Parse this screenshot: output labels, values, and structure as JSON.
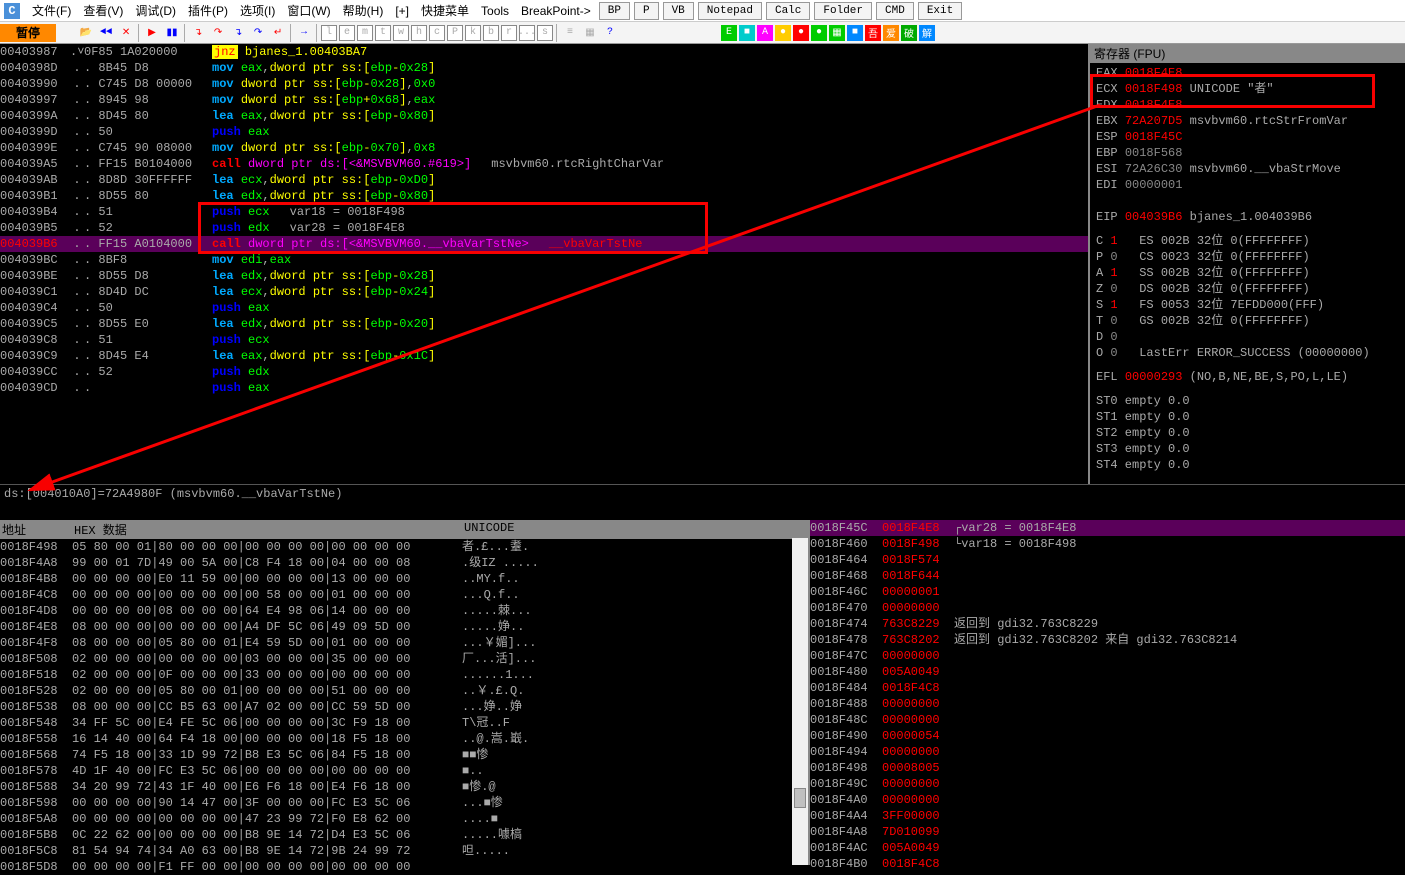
{
  "menu": {
    "items": [
      "文件(F)",
      "查看(V)",
      "调试(D)",
      "插件(P)",
      "选项(I)",
      "窗口(W)",
      "帮助(H)",
      "[+]",
      "快捷菜单",
      "Tools",
      "BreakPoint->"
    ],
    "bp_buttons": [
      "BP",
      "P",
      "VB",
      "Notepad",
      "Calc",
      "Folder",
      "CMD",
      "Exit"
    ]
  },
  "toolbar": {
    "pause_label": "暂停",
    "letters": [
      "l",
      "e",
      "m",
      "t",
      "w",
      "h",
      "c",
      "P",
      "k",
      "b",
      "r",
      "...",
      "s"
    ],
    "cjk_boxes": [
      "吾",
      "爱",
      "破",
      "解"
    ]
  },
  "disasm_title_row": {
    "addr": "00403987",
    "bytes": "0F85 1A020000",
    "label": "bjanes_1.00403BA7"
  },
  "disasm": [
    {
      "addr": "0040398D",
      "bytes": ". 8B45 D8",
      "mn": "mov",
      "ops": "eax,dword ptr ss:[ebp-0x28]"
    },
    {
      "addr": "00403990",
      "bytes": ". C745 D8 00000",
      "mn": "mov",
      "ops": "dword ptr ss:[ebp-0x28],0x0"
    },
    {
      "addr": "00403997",
      "bytes": ". 8945 98",
      "mn": "mov",
      "ops": "dword ptr ss:[ebp+0x68],eax"
    },
    {
      "addr": "0040399A",
      "bytes": ". 8D45 80",
      "mn": "lea",
      "ops": "eax,dword ptr ss:[ebp-0x80]"
    },
    {
      "addr": "0040399D",
      "bytes": ". 50",
      "mn": "push",
      "ops": "eax"
    },
    {
      "addr": "0040399E",
      "bytes": ". C745 90 08000",
      "mn": "mov",
      "ops": "dword ptr ss:[ebp-0x70],0x8"
    },
    {
      "addr": "004039A5",
      "bytes": ". FF15 B0104000",
      "mn": "call",
      "ops": "dword ptr ds:[<&MSVBVM60.#619>]",
      "cm": "msvbvm60.rtcRightCharVar"
    },
    {
      "addr": "004039AB",
      "bytes": ". 8D8D 30FFFFFF",
      "mn": "lea",
      "ops": "ecx,dword ptr ss:[ebp-0xD0]"
    },
    {
      "addr": "004039B1",
      "bytes": ". 8D55 80",
      "mn": "lea",
      "ops": "edx,dword ptr ss:[ebp-0x80]"
    },
    {
      "addr": "004039B4",
      "bytes": ". 51",
      "mn": "push",
      "ops": "ecx",
      "box": true,
      "cm": "var18 = 0018F498"
    },
    {
      "addr": "004039B5",
      "bytes": ". 52",
      "mn": "push",
      "ops": "edx",
      "box": true,
      "cm": "var28 = 0018F4E8"
    },
    {
      "addr": "004039B6",
      "bytes": ". FF15 A0104000",
      "mn": "call",
      "ops": "dword ptr ds:[<&MSVBVM60.__vbaVarTstNe>",
      "hl": true,
      "box": true,
      "red": true,
      "cm2": "__vbaVarTstNe"
    },
    {
      "addr": "004039BC",
      "bytes": ". 8BF8",
      "mn": "mov",
      "ops": "edi,eax"
    },
    {
      "addr": "004039BE",
      "bytes": ". 8D55 D8",
      "mn": "lea",
      "ops": "edx,dword ptr ss:[ebp-0x28]"
    },
    {
      "addr": "004039C1",
      "bytes": ". 8D4D DC",
      "mn": "lea",
      "ops": "ecx,dword ptr ss:[ebp-0x24]"
    },
    {
      "addr": "004039C4",
      "bytes": ". 50",
      "mn": "push",
      "ops": "eax"
    },
    {
      "addr": "004039C5",
      "bytes": ". 8D55 E0",
      "mn": "lea",
      "ops": "edx,dword ptr ss:[ebp-0x20]"
    },
    {
      "addr": "004039C8",
      "bytes": ". 51",
      "mn": "push",
      "ops": "ecx"
    },
    {
      "addr": "004039C9",
      "bytes": ". 8D45 E4",
      "mn": "lea",
      "ops": "eax,dword ptr ss:[ebp-0x1C]"
    },
    {
      "addr": "004039CC",
      "bytes": ". 52",
      "mn": "push",
      "ops": "edx"
    },
    {
      "addr": "004039CD",
      "bytes": ". ",
      "mn": "push",
      "ops": "eax"
    }
  ],
  "dsline": "ds:[004010A0]=72A4980F (msvbvm60.__vbaVarTstNe)",
  "registers_title": "寄存器 (FPU)",
  "registers": [
    {
      "n": "EAX",
      "v": "0018F4E8",
      "red": true
    },
    {
      "n": "ECX",
      "v": "0018F498",
      "red": true,
      "cm": "UNICODE \"者\"",
      "box": true
    },
    {
      "n": "EDX",
      "v": "0018F4E8",
      "red": true,
      "box": true
    },
    {
      "n": "EBX",
      "v": "72A207D5",
      "red": true,
      "cm": "msvbvm60.rtcStrFromVar"
    },
    {
      "n": "ESP",
      "v": "0018F45C",
      "red": true
    },
    {
      "n": "EBP",
      "v": "0018F568"
    },
    {
      "n": "ESI",
      "v": "72A26C30",
      "cm": "msvbvm60.__vbaStrMove"
    },
    {
      "n": "EDI",
      "v": "00000001"
    },
    {
      "n": "",
      "v": ""
    },
    {
      "n": "EIP",
      "v": "004039B6",
      "red": true,
      "cm": "bjanes_1.004039B6"
    }
  ],
  "flags": [
    {
      "n": "C",
      "v": "1",
      "r": "ES 002B 32位 0(FFFFFFFF)"
    },
    {
      "n": "P",
      "v": "0",
      "r": "CS 0023 32位 0(FFFFFFFF)"
    },
    {
      "n": "A",
      "v": "1",
      "r": "SS 002B 32位 0(FFFFFFFF)"
    },
    {
      "n": "Z",
      "v": "0",
      "r": "DS 002B 32位 0(FFFFFFFF)"
    },
    {
      "n": "S",
      "v": "1",
      "r": "FS 0053 32位 7EFDD000(FFF)"
    },
    {
      "n": "T",
      "v": "0",
      "r": "GS 002B 32位 0(FFFFFFFF)"
    },
    {
      "n": "D",
      "v": "0",
      "r": ""
    },
    {
      "n": "O",
      "v": "0",
      "r": "LastErr ERROR_SUCCESS (00000000)"
    }
  ],
  "efl": {
    "n": "EFL",
    "v": "00000293",
    "cm": "(NO,B,NE,BE,S,PO,L,LE)"
  },
  "fpu": [
    "ST0 empty 0.0",
    "ST1 empty 0.0",
    "ST2 empty 0.0",
    "ST3 empty 0.0",
    "ST4 empty 0.0"
  ],
  "hex_headers": {
    "addr": "地址",
    "data": "HEX 数据",
    "uni": "UNICODE"
  },
  "hex": [
    {
      "a": "0018F498",
      "b": "05 80 00 01 80 00 00 00 00 00 00 00 00 00 00 00",
      "u": "者.£...耋."
    },
    {
      "a": "0018F4A8",
      "b": "99 00 01 7D 49 00 5A 00 C8 F4 18 00 04 00 00 08",
      "u": ".级IZ ....."
    },
    {
      "a": "0018F4B8",
      "b": "00 00 00 00 E0 11 59 00 00 00 00 00 13 00 00 00",
      "u": "..MY.f.."
    },
    {
      "a": "0018F4C8",
      "b": "00 00 00 00 00 00 00 00 00 58 00 00 01 00 00 00",
      "u": "...Q.f.."
    },
    {
      "a": "0018F4D8",
      "b": "00 00 00 00 08 00 00 00 64 E4 98 06 14 00 00 00",
      "u": ".....棘..."
    },
    {
      "a": "0018F4E8",
      "b": "08 00 00 00 00 00 00 00 A4 DF 5C 06 49 09 5D 00",
      "u": ".....婙.."
    },
    {
      "a": "0018F4F8",
      "b": "08 00 00 00 05 80 00 01 E4 59 5D 00 01 00 00 00",
      "u": "...￥媚]..."
    },
    {
      "a": "0018F508",
      "b": "02 00 00 00 00 00 00 00 03 00 00 00 35 00 00 00",
      "u": "厂...活]..."
    },
    {
      "a": "0018F518",
      "b": "02 00 00 00 0F 00 00 00 33 00 00 00 00 00 00 00",
      "u": "......1..."
    },
    {
      "a": "0018F528",
      "b": "02 00 00 00 05 80 00 01 00 00 00 00 51 00 00 00",
      "u": "..￥.£.Q."
    },
    {
      "a": "0018F538",
      "b": "08 00 00 00 CC B5 63 00 A7 02 00 00 CC 59 5D 00",
      "u": "...婙..婙"
    },
    {
      "a": "0018F548",
      "b": "34 FF 5C 00 E4 FE 5C 06 00 00 00 00 3C F9 18 00",
      "u": "T\\冠..F"
    },
    {
      "a": "0018F558",
      "b": "16 14 40 00 64 F4 18 00 00 00 00 00 18 F5 18 00",
      "u": "..@.嵩.嶯."
    },
    {
      "a": "0018F568",
      "b": "74 F5 18 00 33 1D 99 72 B8 E3 5C 06 84 F5 18 00",
      "u": "■■惨"
    },
    {
      "a": "0018F578",
      "b": "4D 1F 40 00 FC E3 5C 06 00 00 00 00 00 00 00 00",
      "u": "■.."
    },
    {
      "a": "0018F588",
      "b": "34 20 99 72 43 1F 40 00 E6 F6 18 00 E4 F6 18 00",
      "u": "■惨.@"
    },
    {
      "a": "0018F598",
      "b": "00 00 00 00 90 14 47 00 3F 00 00 00 FC E3 5C 06",
      "u": "...■惨"
    },
    {
      "a": "0018F5A8",
      "b": "00 00 00 00 00 00 00 00 47 23 99 72 F0 E8 62 00",
      "u": "....■"
    },
    {
      "a": "0018F5B8",
      "b": "0C 22 62 00 00 00 00 00 B8 9E 14 72 D4 E3 5C 06",
      "u": ".....噱槁"
    },
    {
      "a": "0018F5C8",
      "b": "81 54 94 74 34 A0 63 00 B8 9E 14 72 9B 24 99 72",
      "u": "呾....."
    },
    {
      "a": "0018F5D8",
      "b": "00 00 00 00 F1 FF 00 00 00 00 00 00 00 00 00 00",
      "u": ""
    }
  ],
  "stack": [
    {
      "a": "0018F45C",
      "v": "0018F4E8",
      "hl": true,
      "c": "┌var28 = 0018F4E8"
    },
    {
      "a": "0018F460",
      "v": "0018F498",
      "c": "└var18 = 0018F498"
    },
    {
      "a": "0018F464",
      "v": "0018F574"
    },
    {
      "a": "0018F468",
      "v": "0018F644"
    },
    {
      "a": "0018F46C",
      "v": "00000001"
    },
    {
      "a": "0018F470",
      "v": "00000000"
    },
    {
      "a": "0018F474",
      "v": "763C8229",
      "c": "返回到 gdi32.763C8229"
    },
    {
      "a": "0018F478",
      "v": "763C8202",
      "c": "返回到 gdi32.763C8202 来自 gdi32.763C8214"
    },
    {
      "a": "0018F47C",
      "v": "00000000"
    },
    {
      "a": "0018F480",
      "v": "005A0049"
    },
    {
      "a": "0018F484",
      "v": "0018F4C8"
    },
    {
      "a": "0018F488",
      "v": "00000000"
    },
    {
      "a": "0018F48C",
      "v": "00000000"
    },
    {
      "a": "0018F490",
      "v": "00000054"
    },
    {
      "a": "0018F494",
      "v": "00000000"
    },
    {
      "a": "0018F498",
      "v": "00008005"
    },
    {
      "a": "0018F49C",
      "v": "00000000"
    },
    {
      "a": "0018F4A0",
      "v": "00000000"
    },
    {
      "a": "0018F4A4",
      "v": "3FF00000"
    },
    {
      "a": "0018F4A8",
      "v": "7D010099"
    },
    {
      "a": "0018F4AC",
      "v": "005A0049"
    },
    {
      "a": "0018F4B0",
      "v": "0018F4C8"
    }
  ]
}
